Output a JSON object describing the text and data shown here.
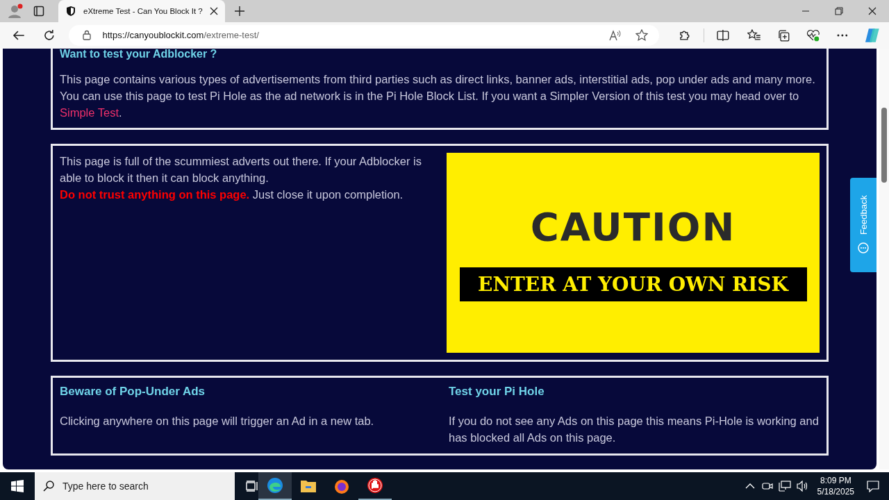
{
  "browser": {
    "tab_title": "eXtreme Test - Can You Block It ?",
    "url_domain": "https://canyoublockit.com",
    "url_path": "/extreme-test/"
  },
  "intro": {
    "heading": "Want to test your Adblocker ?",
    "text": "This page contains various types of advertisements from third parties such as direct links, banner ads, interstitial ads, pop under ads and many more. You can use this page to test Pi Hole as the ad network is in the Pi Hole Block List. If you want a Simpler Version of this test you may head over to ",
    "link": "Simple Test",
    "after": "."
  },
  "warning": {
    "text": "This page is full of the scummiest adverts out there. If your Adblocker is able to block it then it can block anything.",
    "alert": "Do not trust anything on this page.",
    "after": " Just close it upon completion.",
    "banner_title": "CAUTION",
    "banner_subtitle": "ENTER AT YOUR OWN RISK"
  },
  "info": [
    {
      "heading": "Beware of Pop-Under Ads",
      "text": "Clicking anywhere on this page will trigger an Ad in a new tab."
    },
    {
      "heading": "Test your Pi Hole",
      "text": "If you do not see any Ads on this page this means Pi-Hole is working and has blocked all Ads on this page."
    }
  ],
  "feedback": "Feedback",
  "taskbar": {
    "search_placeholder": "Type here to search",
    "time": "8:09 PM",
    "date": "5/18/2025"
  }
}
